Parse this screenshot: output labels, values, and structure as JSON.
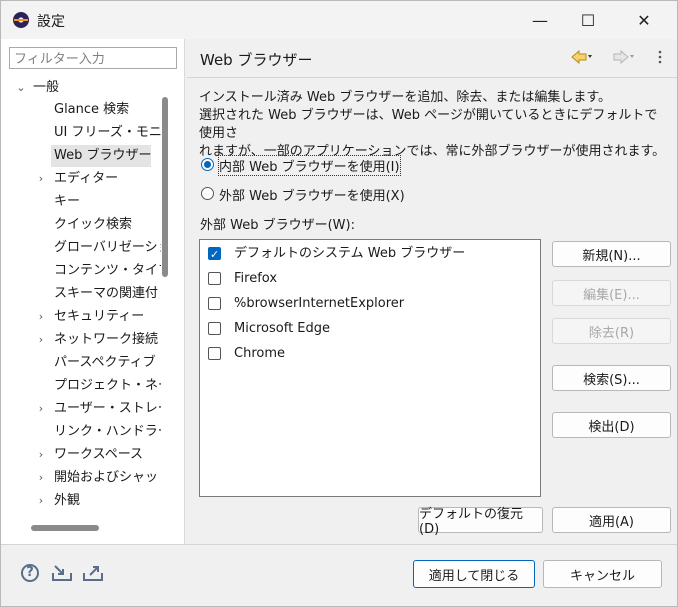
{
  "window": {
    "title": "設定",
    "minimize_glyph": "—",
    "maximize_glyph": "☐",
    "close_glyph": "✕"
  },
  "filter": {
    "placeholder": "フィルター入力"
  },
  "tree": {
    "root": {
      "label": "一般",
      "expanded": true
    },
    "items": [
      {
        "label": "Glance 検索",
        "expandable": false
      },
      {
        "label": "UI フリーズ・モニタ",
        "expandable": false
      },
      {
        "label": "Web ブラウザー",
        "expandable": false,
        "selected": true
      },
      {
        "label": "エディター",
        "expandable": true
      },
      {
        "label": "キー",
        "expandable": false
      },
      {
        "label": "クイック検索",
        "expandable": false
      },
      {
        "label": "グローバリゼーショ",
        "expandable": false
      },
      {
        "label": "コンテンツ・タイプ",
        "expandable": false
      },
      {
        "label": "スキーマの関連付",
        "expandable": false
      },
      {
        "label": "セキュリティー",
        "expandable": true
      },
      {
        "label": "ネットワーク接続",
        "expandable": true
      },
      {
        "label": "パースペクティブ",
        "expandable": false
      },
      {
        "label": "プロジェクト・ネーチ",
        "expandable": false
      },
      {
        "label": "ユーザー・ストレージ",
        "expandable": true
      },
      {
        "label": "リンク・ハンドラー",
        "expandable": false
      },
      {
        "label": "ワークスペース",
        "expandable": true
      },
      {
        "label": "開始およびシャッ",
        "expandable": true
      },
      {
        "label": "外観",
        "expandable": true
      }
    ]
  },
  "page": {
    "heading": "Web ブラウザー",
    "description_line1": "インストール済み Web ブラウザーを追加、除去、または編集します。",
    "description_line2": "選択された Web ブラウザーは、Web ページが開いているときにデフォルトで使用さ",
    "description_line3": "れますが、一部のアプリケーションでは、常に外部ブラウザーが使用されます。",
    "radio_internal": "内部 Web ブラウザーを使用(I)",
    "radio_external": "外部 Web ブラウザーを使用(X)",
    "radio_selected": "internal",
    "list_label": "外部 Web ブラウザー(W):",
    "browsers": [
      {
        "label": "デフォルトのシステム Web ブラウザー",
        "checked": true
      },
      {
        "label": "Firefox",
        "checked": false
      },
      {
        "label": "%browserInternetExplorer",
        "checked": false
      },
      {
        "label": "Microsoft Edge",
        "checked": false
      },
      {
        "label": "Chrome",
        "checked": false
      }
    ],
    "buttons": {
      "new": "新規(N)...",
      "edit": "編集(E)...",
      "remove": "除去(R)",
      "search": "検索(S)...",
      "detect": "検出(D)",
      "restore_defaults": "デフォルトの復元(D)",
      "apply": "適用(A)"
    }
  },
  "footer": {
    "apply_and_close": "適用して閉じる",
    "cancel": "キャンセル"
  },
  "colors": {
    "accent": "#0067c0",
    "selection": "#e4e4e4"
  }
}
